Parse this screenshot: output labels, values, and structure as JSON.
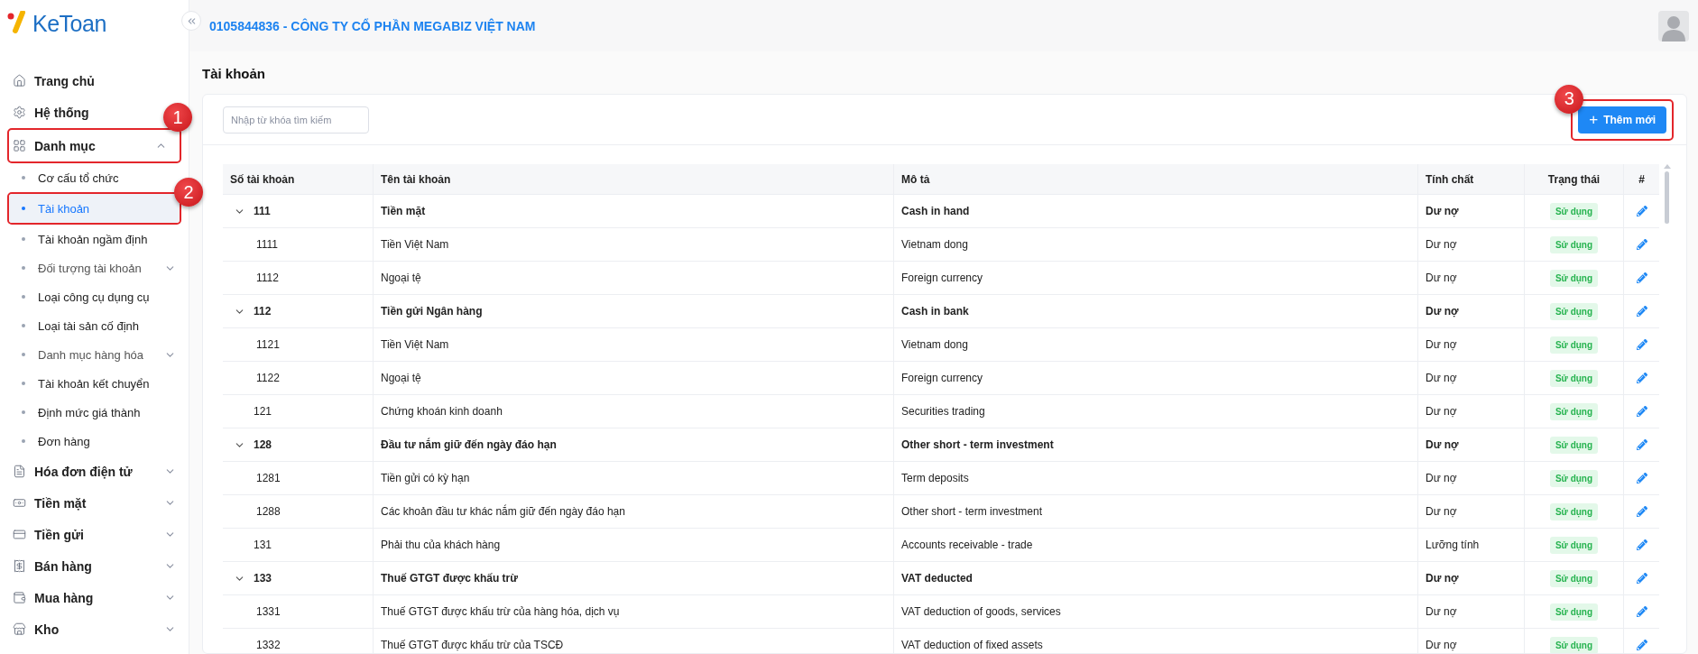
{
  "app": {
    "logo": "KeToan",
    "company": "0105844836 - CÔNG TY CỔ PHẦN MEGABIZ VIỆT NAM"
  },
  "sidebar": {
    "items": [
      {
        "label": "Trang chủ",
        "selected": false
      },
      {
        "label": "Hệ thống",
        "selected": false
      },
      {
        "label": "Danh mục",
        "selected": false,
        "expanded": true,
        "annotation": "1",
        "children": [
          {
            "label": "Cơ cấu tổ chức",
            "selected": false,
            "kind": "link"
          },
          {
            "label": "Tài khoản",
            "selected": true,
            "kind": "link",
            "annotation": "2"
          },
          {
            "label": "Tài khoản ngầm định",
            "selected": false,
            "kind": "link"
          },
          {
            "label": "Đối tượng tài khoản",
            "selected": false,
            "kind": "group",
            "expanded": false
          },
          {
            "label": "Loại công cụ dụng cụ",
            "selected": false,
            "kind": "link"
          },
          {
            "label": "Loại tài sản cố định",
            "selected": false,
            "kind": "link"
          },
          {
            "label": "Danh mục hàng hóa",
            "selected": false,
            "kind": "group",
            "expanded": false
          },
          {
            "label": "Tài khoản kết chuyển",
            "selected": false,
            "kind": "link"
          },
          {
            "label": "Định mức giá thành",
            "selected": false,
            "kind": "link"
          },
          {
            "label": "Đơn hàng",
            "selected": false,
            "kind": "link"
          }
        ]
      },
      {
        "label": "Hóa đơn điện tử",
        "selected": false,
        "expanded": false
      },
      {
        "label": "Tiền mặt",
        "selected": false,
        "expanded": false
      },
      {
        "label": "Tiền gửi",
        "selected": false,
        "expanded": false
      },
      {
        "label": "Bán hàng",
        "selected": false,
        "expanded": false
      },
      {
        "label": "Mua hàng",
        "selected": false,
        "expanded": false
      },
      {
        "label": "Kho",
        "selected": false,
        "expanded": false
      }
    ]
  },
  "page": {
    "title": "Tài khoản",
    "search": {
      "placeholder": "Nhập từ khóa tìm kiếm"
    },
    "add_button": {
      "icon": "+",
      "label": "Thêm mới",
      "annotation": "3"
    }
  },
  "table": {
    "columns": [
      "Số tài khoản",
      "Tên tài khoản",
      "Mô tả",
      "Tính chất",
      "Trạng thái",
      "#"
    ],
    "rows": [
      {
        "account": "111",
        "name": "Tiền mặt",
        "description": "Cash in hand",
        "nature": "Dư nợ",
        "status": "Sử dụng",
        "expanded": true,
        "children": [
          {
            "account": "1111",
            "name": "Tiền Việt Nam",
            "description": "Vietnam dong",
            "nature": "Dư nợ",
            "status": "Sử dụng"
          },
          {
            "account": "1112",
            "name": "Ngoại tệ",
            "description": "Foreign currency",
            "nature": "Dư nợ",
            "status": "Sử dụng"
          }
        ]
      },
      {
        "account": "112",
        "name": "Tiền gửi Ngân hàng",
        "description": "Cash in bank",
        "nature": "Dư nợ",
        "status": "Sử dụng",
        "expanded": true,
        "children": [
          {
            "account": "1121",
            "name": "Tiền Việt Nam",
            "description": "Vietnam dong",
            "nature": "Dư nợ",
            "status": "Sử dụng"
          },
          {
            "account": "1122",
            "name": "Ngoại tệ",
            "description": "Foreign currency",
            "nature": "Dư nợ",
            "status": "Sử dụng"
          }
        ]
      },
      {
        "account": "121",
        "name": "Chứng khoán kinh doanh",
        "description": "Securities trading",
        "nature": "Dư nợ",
        "status": "Sử dụng"
      },
      {
        "account": "128",
        "name": "Đầu tư nắm giữ đến ngày đáo hạn",
        "description": "Other short - term investment",
        "nature": "Dư nợ",
        "status": "Sử dụng",
        "expanded": true,
        "children": [
          {
            "account": "1281",
            "name": "Tiền gửi có kỳ hạn",
            "description": "Term deposits",
            "nature": "Dư nợ",
            "status": "Sử dụng"
          },
          {
            "account": "1288",
            "name": "Các khoản đầu tư khác nắm giữ đến ngày đáo hạn",
            "description": "Other short - term investment",
            "nature": "Dư nợ",
            "status": "Sử dụng"
          }
        ]
      },
      {
        "account": "131",
        "name": "Phải thu của khách hàng",
        "description": "Accounts receivable - trade",
        "nature": "Lưỡng tính",
        "status": "Sử dụng"
      },
      {
        "account": "133",
        "name": "Thuế GTGT được khấu trừ",
        "description": "VAT deducted",
        "nature": "Dư nợ",
        "status": "Sử dụng",
        "expanded": true,
        "children": [
          {
            "account": "1331",
            "name": "Thuế GTGT được khấu trừ của hàng hóa, dịch vụ",
            "description": "VAT deduction of goods, services",
            "nature": "Dư nợ",
            "status": "Sử dụng"
          },
          {
            "account": "1332",
            "name": "Thuế GTGT được khấu trừ của TSCĐ",
            "description": "VAT deduction of fixed assets",
            "nature": "Dư nợ",
            "status": "Sử dụng"
          }
        ]
      }
    ]
  }
}
